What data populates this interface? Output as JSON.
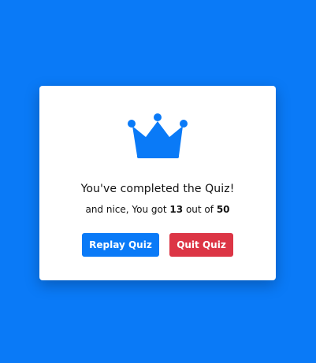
{
  "result": {
    "headline": "You've completed the Quiz!",
    "score_prefix": "and nice, You got",
    "score_value": "13",
    "score_middle": "out of",
    "score_total": "50",
    "crown_icon": "crown-icon"
  },
  "actions": {
    "replay_label": "Replay Quiz",
    "quit_label": "Quit Quiz"
  },
  "colors": {
    "background": "#0a7af7",
    "primary": "#0a7af7",
    "danger": "#dc3545",
    "card": "#ffffff"
  }
}
